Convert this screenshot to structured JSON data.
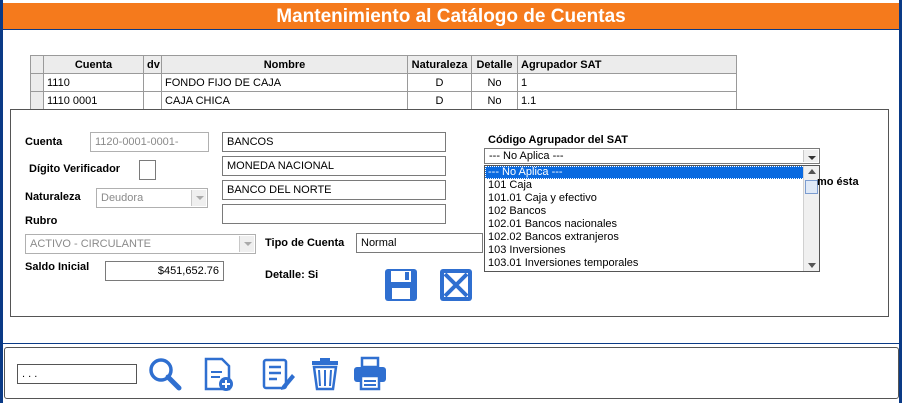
{
  "window": {
    "title": "Mantenimiento al Catálogo de Cuentas"
  },
  "grid": {
    "columns": [
      "Cuenta",
      "dv",
      "Nombre",
      "Naturaleza",
      "Detalle",
      "Agrupador SAT"
    ],
    "rows": [
      {
        "cuenta": "1110",
        "dv": "",
        "nombre": "FONDO FIJO DE CAJA",
        "naturaleza": "D",
        "detalle": "No",
        "agrupador": "1"
      },
      {
        "cuenta": "1110 0001",
        "dv": "",
        "nombre": "CAJA CHICA",
        "naturaleza": "D",
        "detalle": "No",
        "agrupador": "1.1"
      }
    ]
  },
  "form": {
    "cuenta_label": "Cuenta",
    "cuenta_value": "1120-0001-0001-",
    "digito_label": "Dígito Verificador",
    "digito_value": "",
    "naturaleza_label": "Naturaleza",
    "naturaleza_value": "Deudora",
    "rubro_label": "Rubro",
    "rubro_value": "ACTIVO - CIRCULANTE",
    "saldo_label": "Saldo Inicial",
    "saldo_value": "$451,652.76",
    "nombre_lines": [
      "BANCOS",
      "MONEDA NACIONAL",
      "BANCO DEL NORTE",
      ""
    ],
    "tipo_label": "Tipo de Cuenta",
    "tipo_value": "Normal",
    "detalle_label": "Detalle:",
    "detalle_value": "Si",
    "sat_label": "Código Agrupador del SAT",
    "sat_value": "--- No Aplica ---",
    "partial_text": "mo ésta",
    "sat_options": [
      "--- No Aplica ---",
      "101 Caja",
      "101.01 Caja y efectivo",
      "102 Bancos",
      "102.01 Bancos nacionales",
      "102.02 Bancos extranjeros",
      "103 Inversiones",
      "103.01 Inversiones temporales"
    ]
  },
  "toolbar": {
    "search_value": " .  .  . "
  },
  "colors": {
    "title_bg": "#f57a1c",
    "frame": "#0a3a86",
    "icon_blue": "#2f6fd0"
  }
}
